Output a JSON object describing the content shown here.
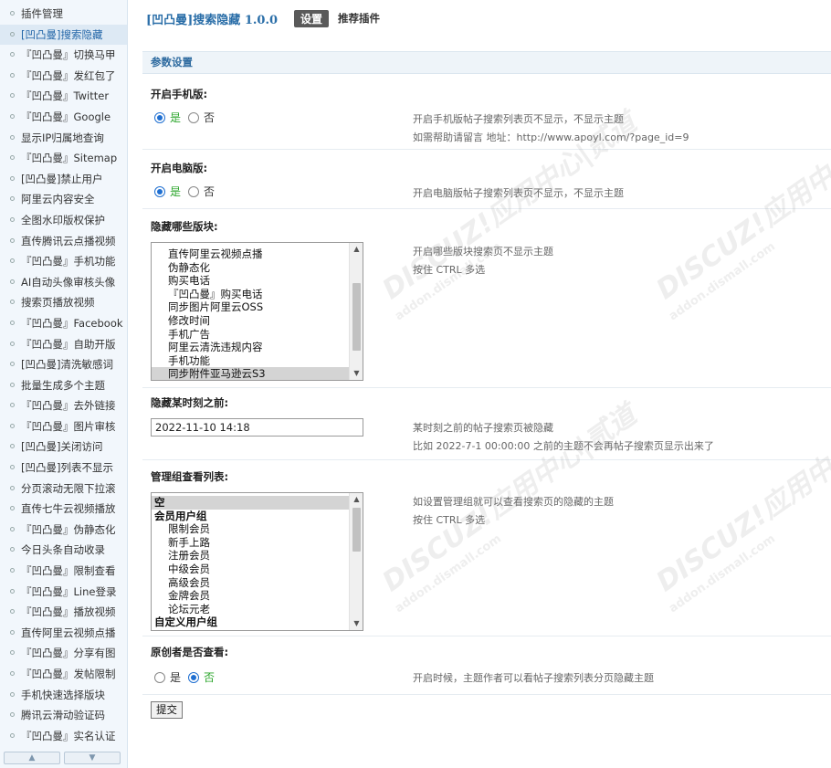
{
  "sidebar": {
    "items": [
      "插件管理",
      "[凹凸曼]搜索隐藏",
      "『凹凸曼』切换马甲",
      "『凹凸曼』发红包了",
      "『凹凸曼』Twitter",
      "『凹凸曼』Google",
      "显示IP归属地查询",
      "『凹凸曼』Sitemap",
      "[凹凸曼]禁止用户",
      "阿里云内容安全",
      "全图水印版权保护",
      "直传腾讯云点播视频",
      "『凹凸曼』手机功能",
      "AI自动头像审核头像",
      "搜索页播放视频",
      "『凹凸曼』Facebook",
      "『凹凸曼』自助开版",
      "[凹凸曼]清洗敏感词",
      "批量生成多个主题",
      "『凹凸曼』去外链接",
      "『凹凸曼』图片审核",
      "[凹凸曼]关闭访问",
      "[凹凸曼]列表不显示",
      "分页滚动无限下拉滚",
      "直传七牛云视频播放",
      "『凹凸曼』伪静态化",
      "今日头条自动收录",
      "『凹凸曼』限制查看",
      "『凹凸曼』Line登录",
      "『凹凸曼』播放视频",
      "直传阿里云视频点播",
      "『凹凸曼』分享有图",
      "『凹凸曼』发帖限制",
      "手机快速选择版块",
      "腾讯云滑动验证码",
      "『凹凸曼』实名认证"
    ],
    "active_index": 1,
    "nav_up": "▲",
    "nav_down": "▼"
  },
  "header": {
    "title": "[凹凸曼]搜索隐藏 1.0.0",
    "tab_settings": "设置",
    "tab_recommend": "推荐插件"
  },
  "section": {
    "title": "参数设置"
  },
  "fields": {
    "mobile": {
      "label": "开启手机版:",
      "yes": "是",
      "no": "否",
      "selected": "yes",
      "desc1": "开启手机版帖子搜索列表页不显示，不显示主题",
      "desc2": "如需帮助请留言 地址：http://www.apoyl.com/?page_id=9"
    },
    "pc": {
      "label": "开启电脑版:",
      "yes": "是",
      "no": "否",
      "selected": "yes",
      "desc1": "开启电脑版帖子搜索列表页不显示，不显示主题"
    },
    "forums": {
      "label": "隐藏哪些版块:",
      "options": [
        "直传阿里云视频点播",
        "伪静态化",
        "购买电话",
        "『凹凸曼』购买电话",
        "同步图片阿里云OSS",
        "修改时间",
        "手机广告",
        "阿里云清洗违规内容",
        "手机功能",
        "同步附件亚马逊云S3"
      ],
      "selected_index": 9,
      "desc1": "开启哪些版块搜索页不显示主题",
      "desc2": "按住 CTRL 多选"
    },
    "time": {
      "label": "隐藏某时刻之前:",
      "value": "2022-11-10 14:18",
      "desc1": "某时刻之前的帖子搜索页被隐藏",
      "desc2": "比如 2022-7-1 00:00:00 之前的主题不会再帖子搜索页显示出来了"
    },
    "groups": {
      "label": "管理组查看列表:",
      "options": [
        {
          "text": "空",
          "group": true
        },
        {
          "text": "会员用户组",
          "group": true
        },
        {
          "text": "限制会员",
          "group": false
        },
        {
          "text": "新手上路",
          "group": false
        },
        {
          "text": "注册会员",
          "group": false
        },
        {
          "text": "中级会员",
          "group": false
        },
        {
          "text": "高级会员",
          "group": false
        },
        {
          "text": "金牌会员",
          "group": false
        },
        {
          "text": "论坛元老",
          "group": false
        },
        {
          "text": "自定义用户组",
          "group": true
        }
      ],
      "selected_index": 0,
      "desc1": "如设置管理组就可以查看搜索页的隐藏的主题",
      "desc2": "按住 CTRL 多选"
    },
    "author": {
      "label": "原创者是否查看:",
      "yes": "是",
      "no": "否",
      "selected": "no",
      "desc1": "开启时候，主题作者可以看帖子搜索列表分页隐藏主题"
    }
  },
  "submit_label": "提交",
  "watermark": {
    "brand": "DISCUZ!应用中心|贰道",
    "url": "addon.dismall.com"
  },
  "colors": {
    "accent": "#2a6ea8",
    "radio_on": "#1f6fd1",
    "yes_text": "#2aa52a"
  }
}
